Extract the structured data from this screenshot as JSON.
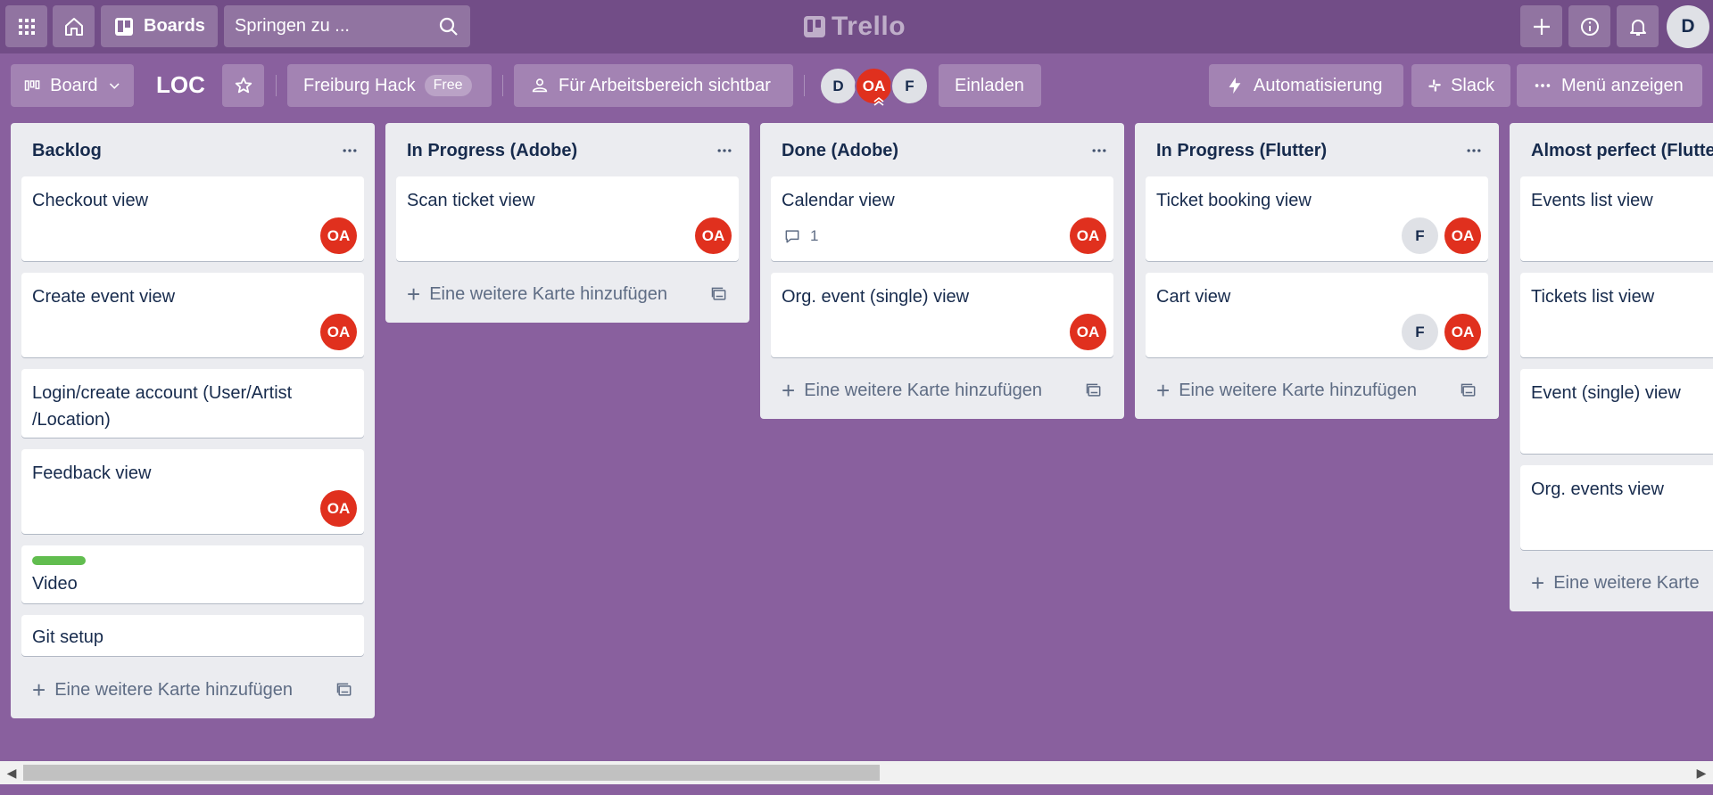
{
  "header": {
    "boards_label": "Boards",
    "search_placeholder": "Springen zu ...",
    "logo_text": "Trello",
    "user_initial": "D"
  },
  "board_header": {
    "view_label": "Board",
    "title": "LOC",
    "workspace_name": "Freiburg Hack",
    "workspace_plan": "Free",
    "visibility_label": "Für Arbeitsbereich sichtbar",
    "members": [
      "D",
      "OA",
      "F"
    ],
    "invite_label": "Einladen",
    "automation_label": "Automatisierung",
    "slack_label": "Slack",
    "menu_label": "Menü anzeigen"
  },
  "add_card_label": "Eine weitere Karte hinzufügen",
  "lists": [
    {
      "title": "Backlog",
      "cards": [
        {
          "title": "Checkout view",
          "members": [
            "OA"
          ]
        },
        {
          "title": "Create event view",
          "members": [
            "OA"
          ]
        },
        {
          "title": "Login/create account (User/Artist /Location)",
          "members": []
        },
        {
          "title": "Feedback view",
          "members": [
            "OA"
          ]
        },
        {
          "title": "Video",
          "members": [],
          "label_color": "#61bd4f"
        },
        {
          "title": "Git setup",
          "members": []
        }
      ]
    },
    {
      "title": "In Progress (Adobe)",
      "cards": [
        {
          "title": "Scan ticket view",
          "members": [
            "OA"
          ]
        }
      ]
    },
    {
      "title": "Done (Adobe)",
      "cards": [
        {
          "title": "Calendar view",
          "members": [
            "OA"
          ],
          "comments": "1"
        },
        {
          "title": "Org. event (single) view",
          "members": [
            "OA"
          ]
        }
      ]
    },
    {
      "title": "In Progress (Flutter)",
      "cards": [
        {
          "title": "Ticket booking view",
          "members": [
            "F",
            "OA"
          ]
        },
        {
          "title": "Cart view",
          "members": [
            "F",
            "OA"
          ]
        }
      ]
    },
    {
      "title": "Almost perfect (Flutte",
      "cards": [
        {
          "title": "Events list view",
          "members": []
        },
        {
          "title": "Tickets list view",
          "members": []
        },
        {
          "title": "Event (single) view",
          "members": []
        },
        {
          "title": "Org. events view",
          "members": []
        }
      ]
    }
  ],
  "add_card_truncated": "Eine weitere Karte",
  "colors": {
    "board_background": "#89609e",
    "header_background": "#724d87",
    "member_red": "#e0301e",
    "list_background": "#ebecf0"
  }
}
